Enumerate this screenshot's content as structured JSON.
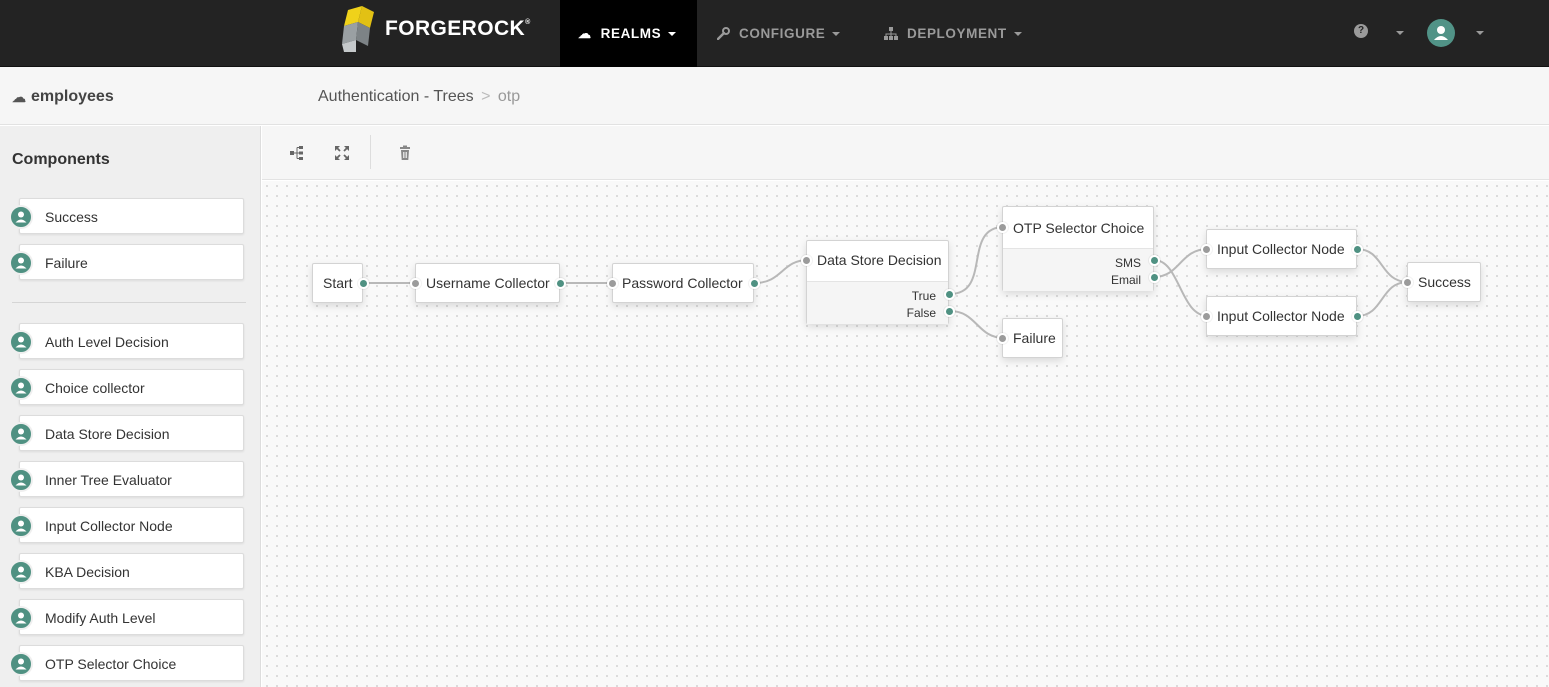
{
  "brand": {
    "name": "FORGEROCK"
  },
  "nav": {
    "realms": "REALMS",
    "configure": "CONFIGURE",
    "deployment": "DEPLOYMENT"
  },
  "subheader": {
    "realm": "employees",
    "breadcrumb_parent": "Authentication - Trees",
    "breadcrumb_separator": ">",
    "breadcrumb_current": "otp"
  },
  "sidebar": {
    "title": "Components",
    "terminals": [
      "Success",
      "Failure"
    ],
    "items": [
      "Auth Level Decision",
      "Choice collector",
      "Data Store Decision",
      "Inner Tree Evaluator",
      "Input Collector Node",
      "KBA Decision",
      "Modify Auth Level",
      "OTP Selector Choice"
    ]
  },
  "tree": {
    "start": "Start",
    "username": "Username Collector",
    "password": "Password Collector",
    "datastore": {
      "title": "Data Store Decision",
      "outcome_true": "True",
      "outcome_false": "False"
    },
    "otp": {
      "title": "OTP Selector Choice",
      "outcome_sms": "SMS",
      "outcome_email": "Email"
    },
    "failure": "Failure",
    "input1": "Input Collector Node",
    "input2": "Input Collector Node",
    "success": "Success"
  },
  "colors": {
    "accent": "#4f9182",
    "nav_bg": "#232323",
    "input_port": "#9b9b9b",
    "wire": "#b8b8b8"
  },
  "icons": {
    "realms": "cloud-icon",
    "configure": "wrench-icon",
    "deployment": "sitemap-icon",
    "help": "question-circle-icon",
    "user": "user-avatar-icon",
    "layout": "auto-layout-icon",
    "fullscreen": "expand-icon",
    "delete": "trash-icon",
    "component": "user-icon"
  }
}
